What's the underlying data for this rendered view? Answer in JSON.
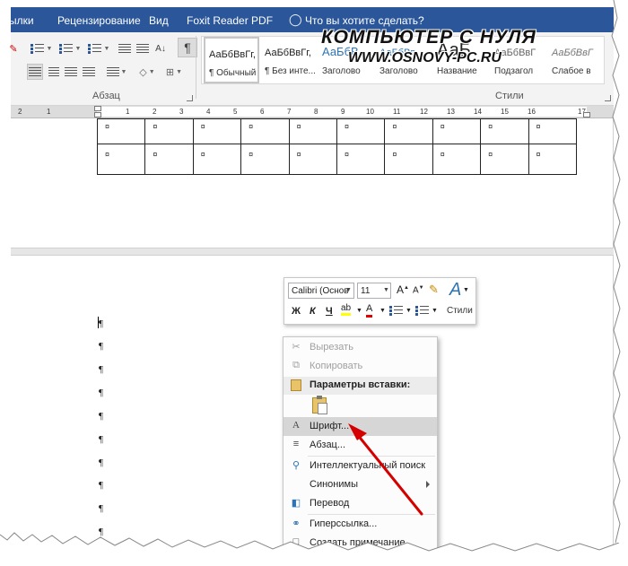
{
  "ribbon": {
    "tabs": [
      "ылки",
      "Рецензирование",
      "Вид",
      "Foxit Reader PDF"
    ],
    "tell_me": "Что вы хотите сделать?",
    "groups": {
      "paragraph_label": "Абзац",
      "styles_label": "Стили"
    },
    "styles": [
      {
        "sample": "АаБбВвГг,",
        "name": "¶ Обычный"
      },
      {
        "sample": "АаБбВвГг,",
        "name": "¶ Без инте..."
      },
      {
        "sample": "АаБбВ",
        "name": "Заголово"
      },
      {
        "sample": "АаБбВв",
        "name": "Заголово"
      },
      {
        "sample": "АаБ",
        "name": "Название"
      },
      {
        "sample": "АаБбВвГ",
        "name": "Подзагол"
      },
      {
        "sample": "АаБбВвГ",
        "name": "Слабое в"
      }
    ],
    "pilcrow_button": "¶"
  },
  "watermark": {
    "line1": "КОМПЬЮТЕР С НУЛЯ",
    "line2": "WWW.OSNOVY-PC.RU"
  },
  "ruler": {
    "numbers": [
      "2",
      "1",
      "1",
      "2",
      "3",
      "4",
      "5",
      "6",
      "7",
      "8",
      "9",
      "10",
      "11",
      "12",
      "13",
      "14",
      "15",
      "16",
      "17"
    ]
  },
  "document": {
    "table_cell_mark": "¤",
    "paragraph_mark": "¶"
  },
  "mini_toolbar": {
    "font_name": "Calibri (Основ",
    "font_size": "11",
    "bold": "Ж",
    "italic": "К",
    "underline": "Ч",
    "font_color_letter": "А",
    "styles_label": "Стили"
  },
  "context_menu": {
    "cut": "Вырезать",
    "copy": "Копировать",
    "paste_options": "Параметры вставки:",
    "font": "Шрифт...",
    "paragraph": "Абзац...",
    "smart_lookup": "Интеллектуальный поиск",
    "synonyms": "Синонимы",
    "translate": "Перевод",
    "hyperlink": "Гиперссылка...",
    "new_comment": "Создать примечание"
  }
}
